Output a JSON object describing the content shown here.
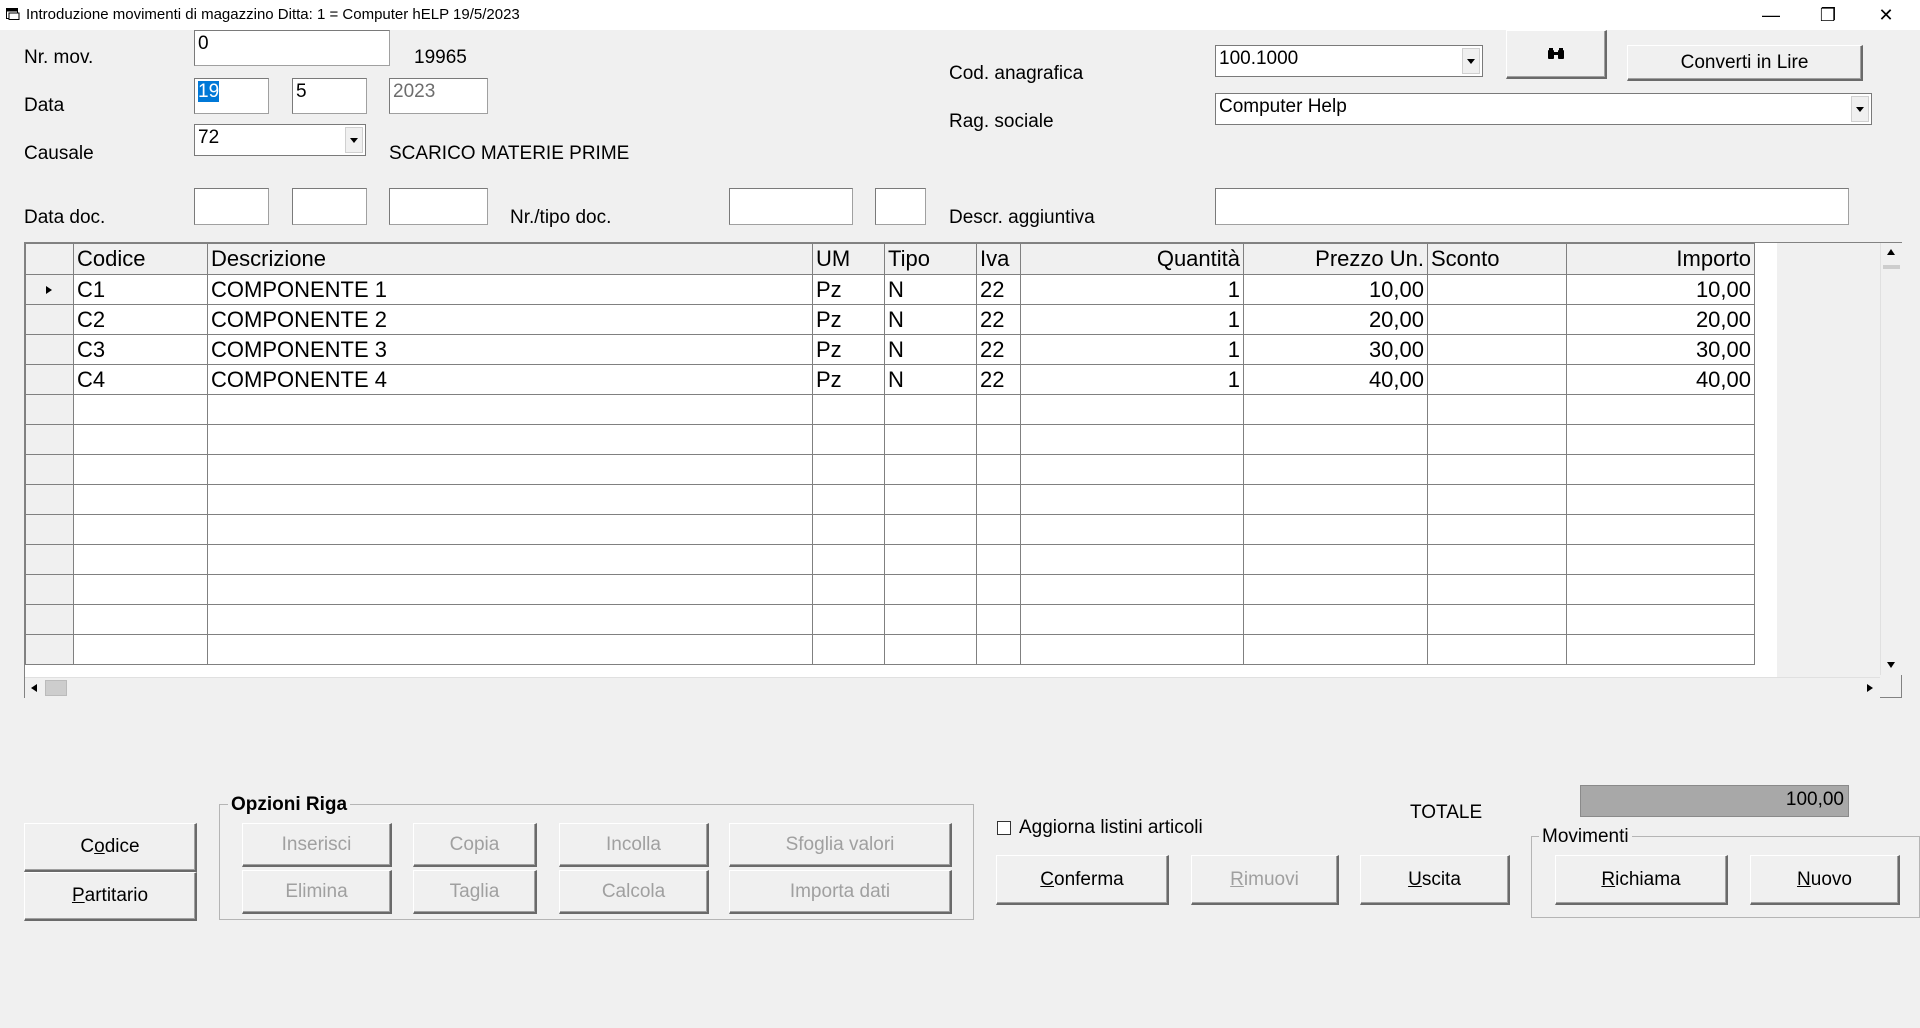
{
  "window": {
    "title": "Introduzione movimenti di magazzino  Ditta: 1 = Computer hELP  19/5/2023",
    "minimize": "—",
    "maximize": "❐",
    "close": "✕"
  },
  "form": {
    "nr_mov_label": "Nr. mov.",
    "nr_mov_value": "0",
    "nr_mov_number": "19965",
    "data_label": "Data",
    "data_day": "19",
    "data_month": "5",
    "data_year": "2023",
    "causale_label": "Causale",
    "causale_value": "72",
    "causale_desc": "SCARICO MATERIE PRIME",
    "cod_anagrafica_label": "Cod. anagrafica",
    "cod_anagrafica_value": "100.1000",
    "rag_sociale_label": "Rag. sociale",
    "rag_sociale_value": "Computer Help",
    "converti_label": "Converti in Lire",
    "data_doc_label": "Data doc.",
    "nr_tipo_doc_label": "Nr./tipo doc.",
    "descr_agg_label": "Descr. aggiuntiva"
  },
  "grid": {
    "columns": [
      "Codice",
      "Descrizione",
      "UM",
      "Tipo",
      "Iva",
      "Quantità",
      "Prezzo Un.",
      "Sconto",
      "Importo"
    ],
    "rows": [
      [
        "C1",
        "COMPONENTE 1",
        "Pz",
        "N",
        "22",
        "1",
        "10,00",
        "",
        "10,00"
      ],
      [
        "C2",
        "COMPONENTE 2",
        "Pz",
        "N",
        "22",
        "1",
        "20,00",
        "",
        "20,00"
      ],
      [
        "C3",
        "COMPONENTE 3",
        "Pz",
        "N",
        "22",
        "1",
        "30,00",
        "",
        "30,00"
      ],
      [
        "C4",
        "COMPONENTE 4",
        "Pz",
        "N",
        "22",
        "1",
        "40,00",
        "",
        "40,00"
      ]
    ],
    "empty_rows": 9
  },
  "left_buttons": {
    "codice": "Codice",
    "partitario": "Partitario"
  },
  "opzioni_riga": {
    "title": "Opzioni Riga",
    "buttons": [
      "Inserisci",
      "Copia",
      "Incolla",
      "Sfoglia valori",
      "Elimina",
      "Taglia",
      "Calcola",
      "Importa dati"
    ]
  },
  "aggiorna_label": "Aggiorna listini articoli",
  "totale_label": "TOTALE",
  "totale_value": "100,00",
  "actions": {
    "conferma": "Conferma",
    "rimuovi": "Rimuovi",
    "uscita": "Uscita"
  },
  "movimenti": {
    "title": "Movimenti",
    "richiama": "Richiama",
    "nuovo": "Nuovo"
  }
}
